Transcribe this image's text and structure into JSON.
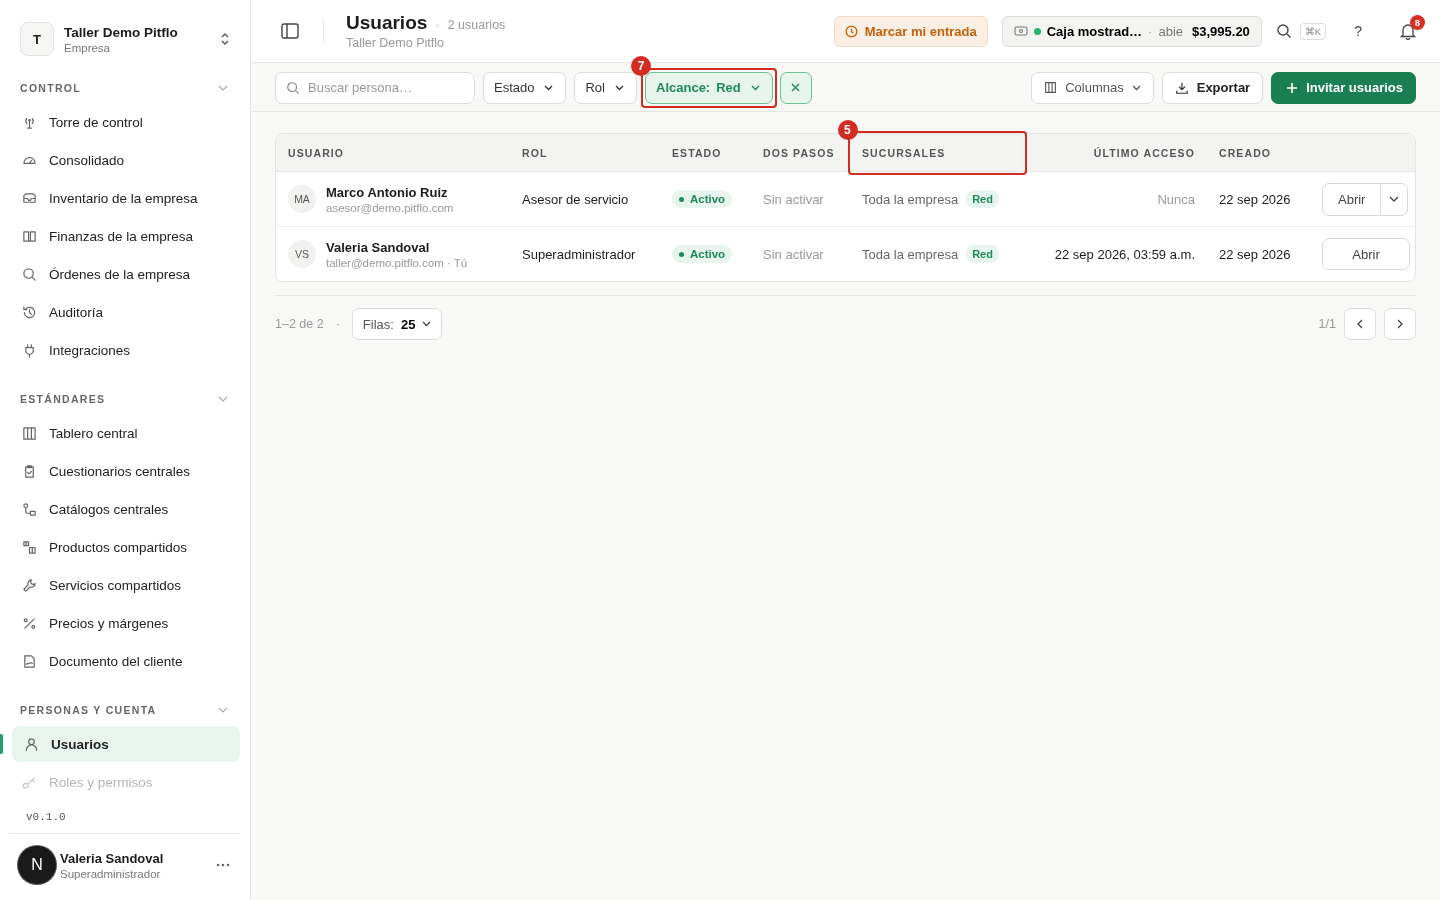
{
  "workspace": {
    "initial": "T",
    "name": "Taller Demo Pitflo",
    "subtitle": "Empresa"
  },
  "sidebar": {
    "sections": [
      {
        "title": "CONTROL",
        "expanded": true,
        "items": [
          {
            "label": "Torre de control",
            "selected": false,
            "disabled": false
          },
          {
            "label": "Consolidado",
            "selected": false,
            "disabled": false
          },
          {
            "label": "Inventario de la empresa",
            "selected": false,
            "disabled": false
          },
          {
            "label": "Finanzas de la empresa",
            "selected": false,
            "disabled": false
          },
          {
            "label": "Órdenes de la empresa",
            "selected": false,
            "disabled": false
          },
          {
            "label": "Auditoría",
            "selected": false,
            "disabled": false
          },
          {
            "label": "Integraciones",
            "selected": false,
            "disabled": false
          }
        ]
      },
      {
        "title": "ESTÁNDARES",
        "expanded": true,
        "items": [
          {
            "label": "Tablero central",
            "selected": false,
            "disabled": false
          },
          {
            "label": "Cuestionarios centrales",
            "selected": false,
            "disabled": false
          },
          {
            "label": "Catálogos centrales",
            "selected": false,
            "disabled": false
          },
          {
            "label": "Productos compartidos",
            "selected": false,
            "disabled": false
          },
          {
            "label": "Servicios compartidos",
            "selected": false,
            "disabled": false
          },
          {
            "label": "Precios y márgenes",
            "selected": false,
            "disabled": false
          },
          {
            "label": "Documento del cliente",
            "selected": false,
            "disabled": false
          }
        ]
      },
      {
        "title": "PERSONAS Y CUENTA",
        "expanded": true,
        "items": [
          {
            "label": "Usuarios",
            "selected": true,
            "disabled": false
          },
          {
            "label": "Roles y permisos",
            "selected": false,
            "disabled": true
          }
        ]
      }
    ],
    "version": "v0.1.0"
  },
  "user": {
    "initial": "N",
    "name": "Valeria Sandoval",
    "role": "Superadministrador"
  },
  "header": {
    "title": "Usuarios",
    "separator": "·",
    "count": "2 usuarios",
    "subtitle": "Taller Demo Pitflo",
    "clock_in": "Marcar mi entrada",
    "register": {
      "name": "Caja mostrad…",
      "separator": "·",
      "status": "abie",
      "amount": "$3,995.20"
    },
    "shortcut": "⌘K",
    "help": "?",
    "notifications": "8"
  },
  "toolbar": {
    "search": {
      "placeholder": "Buscar persona…"
    },
    "filters": [
      {
        "label": "Estado",
        "active": false
      },
      {
        "label": "Rol",
        "active": false
      },
      {
        "label": "Alcance:",
        "value": "Red",
        "active": true,
        "annotation": "7"
      }
    ],
    "columns_button": "Columnas",
    "export_button": "Exportar",
    "invite_button": "Invitar usuarios"
  },
  "table": {
    "columns": [
      {
        "label": "USUARIO"
      },
      {
        "label": "ROL"
      },
      {
        "label": "ESTADO"
      },
      {
        "label": "DOS PASOS"
      },
      {
        "label": "SUCURSALES",
        "annotation": "5"
      },
      {
        "label": "ÚLTIMO ACCESO"
      },
      {
        "label": "CREADO"
      }
    ],
    "rows": [
      {
        "initials": "MA",
        "name": "Marco Antonio Ruiz",
        "email": "asesor@demo.pitflo.com",
        "role": "Asesor de servicio",
        "status": "Activo",
        "two_step": "Sin activar",
        "scope": "Toda la empresa",
        "scope_tag": "Red",
        "last_access": "Nunca",
        "last_access_muted": true,
        "created": "22 sep 2026",
        "action": "Abrir",
        "has_menu": true
      },
      {
        "initials": "VS",
        "name": "Valeria Sandoval",
        "email": "taller@demo.pitflo.com · Tú",
        "role": "Superadministrador",
        "status": "Activo",
        "two_step": "Sin activar",
        "scope": "Toda la empresa",
        "scope_tag": "Red",
        "last_access": "22 sep 2026, 03:59 a.m.",
        "last_access_muted": false,
        "created": "22 sep 2026",
        "action": "Abrir",
        "has_menu": false
      }
    ]
  },
  "footer": {
    "range": "1–2 de 2",
    "separator": "·",
    "rows_label": "Filas:",
    "rows_value": "25",
    "page": "1/1"
  }
}
